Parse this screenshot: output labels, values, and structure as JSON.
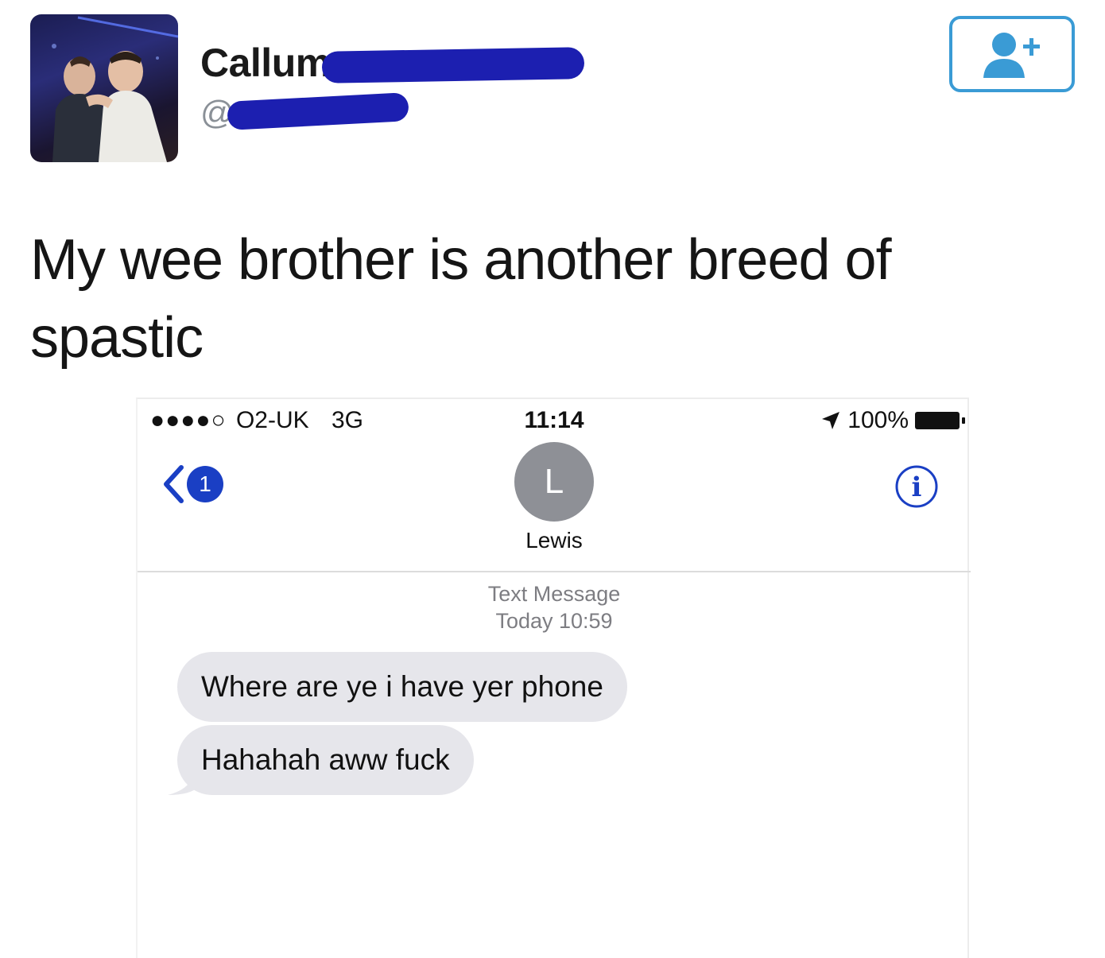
{
  "tweet": {
    "display_name": "Callum",
    "handle": "@",
    "text_line1": "My wee brother is another breed of",
    "text_line2": "spastic",
    "follow_icon": "add-user-icon",
    "colors": {
      "follow_border": "#3a9bd5",
      "redaction": "#1c1fb0"
    }
  },
  "phone": {
    "status": {
      "signal": "●●●●○",
      "carrier": "O2-UK",
      "network": "3G",
      "time": "11:14",
      "battery": "100%"
    },
    "nav": {
      "back_count": "1",
      "contact_initial": "L",
      "contact_name": "Lewis"
    },
    "thread_label": "Text Message",
    "thread_time": "Today 10:59",
    "messages": [
      {
        "text": "Where are ye i have yer phone"
      },
      {
        "text": "Hahahah aww fuck"
      }
    ],
    "colors": {
      "badge": "#1a3fc4",
      "bubble": "#e6e6eb",
      "info": "#1a3fc4"
    }
  }
}
